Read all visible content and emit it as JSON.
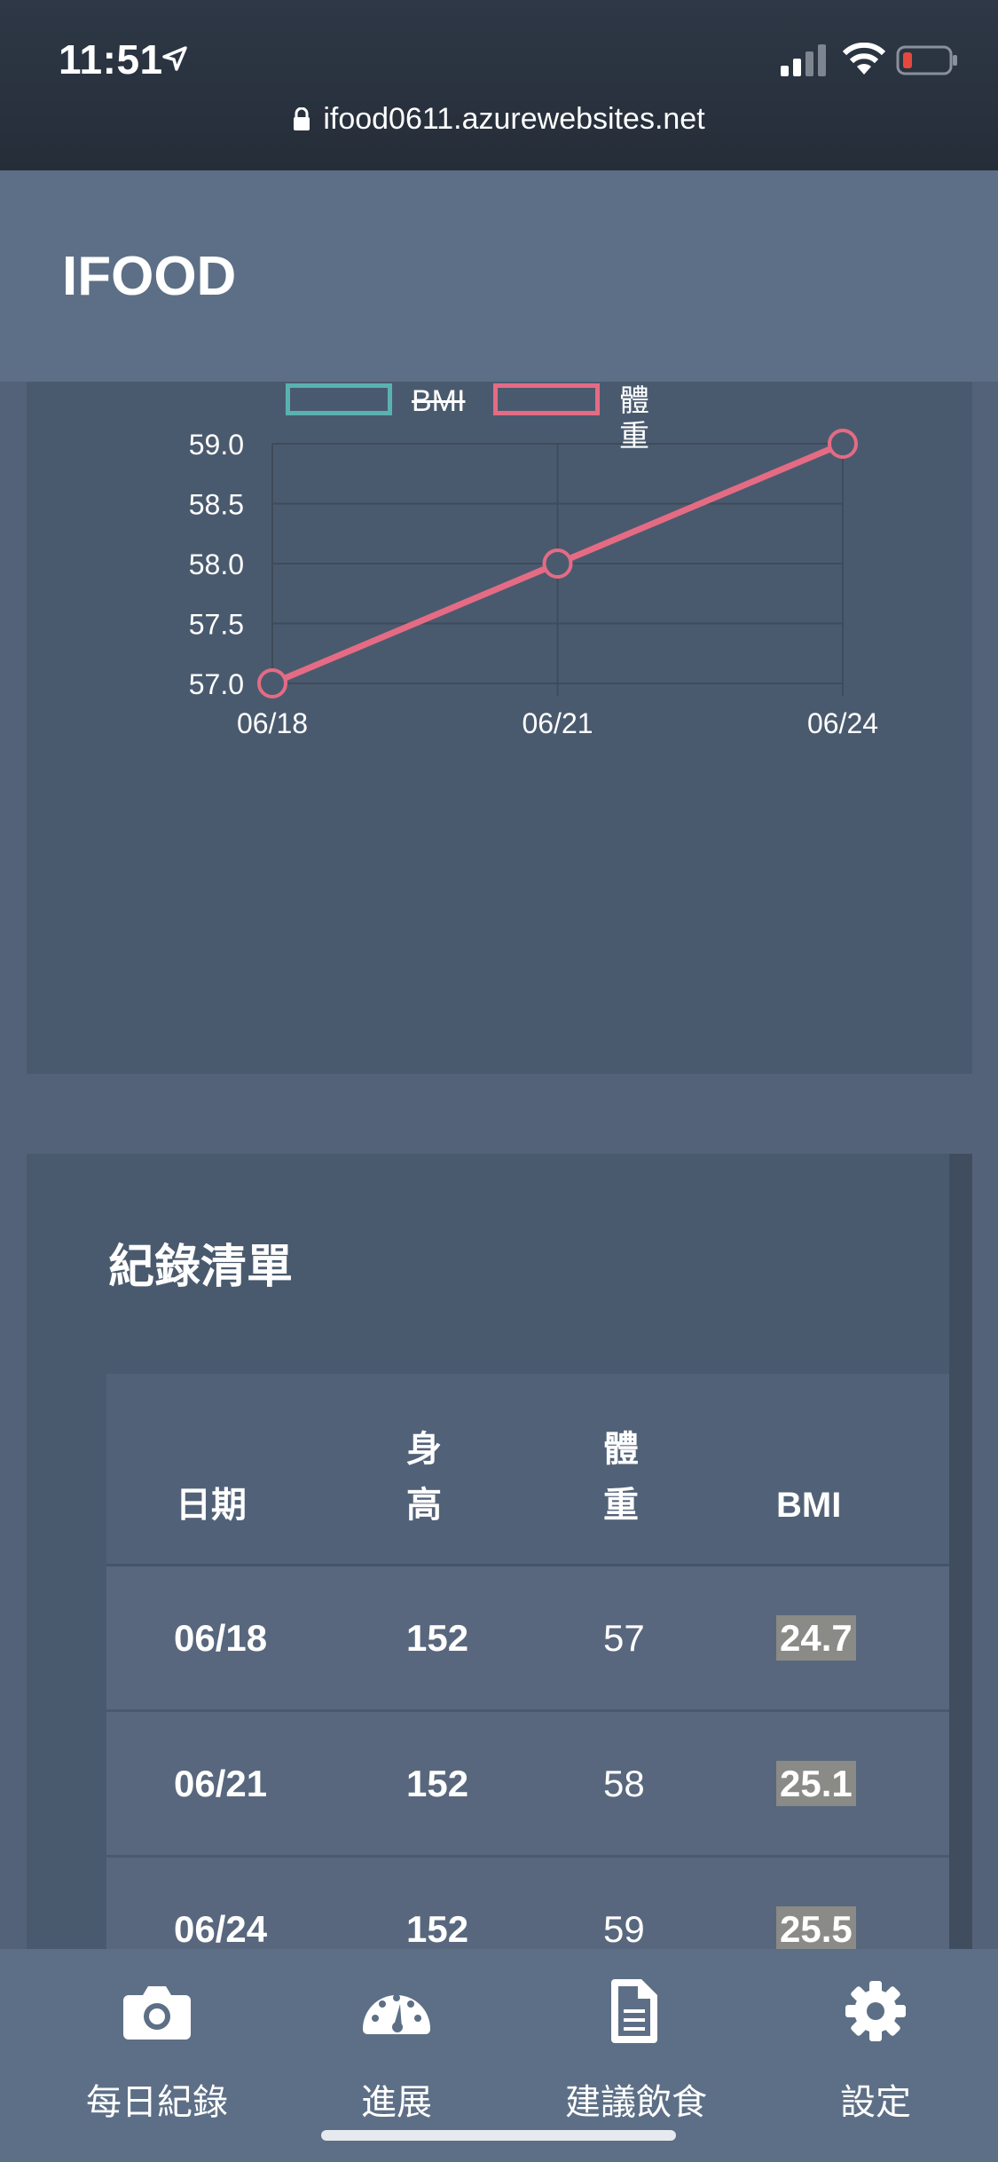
{
  "status_bar": {
    "time": "11:51",
    "url": "ifood0611.azurewebsites.net"
  },
  "app": {
    "title": "IFOOD"
  },
  "chart": {
    "legend": [
      "BMI",
      "體重"
    ],
    "chart_data": {
      "type": "line",
      "x": [
        "06/18",
        "06/21",
        "06/24"
      ],
      "series": [
        {
          "name": "BMI",
          "values": [
            24.7,
            25.1,
            25.5
          ],
          "color": "#5ab2b0",
          "hidden": true
        },
        {
          "name": "體重",
          "values": [
            57,
            58,
            59
          ],
          "color": "#e56b84"
        }
      ],
      "ylim": [
        57.0,
        59.0
      ],
      "yticks": [
        "57.0",
        "57.5",
        "58.0",
        "58.5",
        "59.0"
      ],
      "grid": true,
      "legend_position": "top"
    }
  },
  "records": {
    "title": "紀錄清單",
    "headers": {
      "date": "日期",
      "height_1": "身",
      "height_2": "高",
      "weight_1": "體",
      "weight_2": "重",
      "bmi": "BMI"
    },
    "rows": [
      {
        "date": "06/18",
        "height": "152",
        "weight": "57",
        "bmi": "24.7"
      },
      {
        "date": "06/21",
        "height": "152",
        "weight": "58",
        "bmi": "25.1"
      },
      {
        "date": "06/24",
        "height": "152",
        "weight": "59",
        "bmi": "25.5"
      }
    ]
  },
  "nav": {
    "items": [
      {
        "label": "每日紀錄",
        "icon": "camera-icon"
      },
      {
        "label": "進展",
        "icon": "dashboard-icon"
      },
      {
        "label": "建議飲食",
        "icon": "document-icon"
      },
      {
        "label": "設定",
        "icon": "gear-icon"
      }
    ]
  },
  "colors": {
    "accent": "#e56b84",
    "bmi": "#5ab2b0",
    "header": "#5d6f86",
    "card": "#4a5a6e"
  }
}
